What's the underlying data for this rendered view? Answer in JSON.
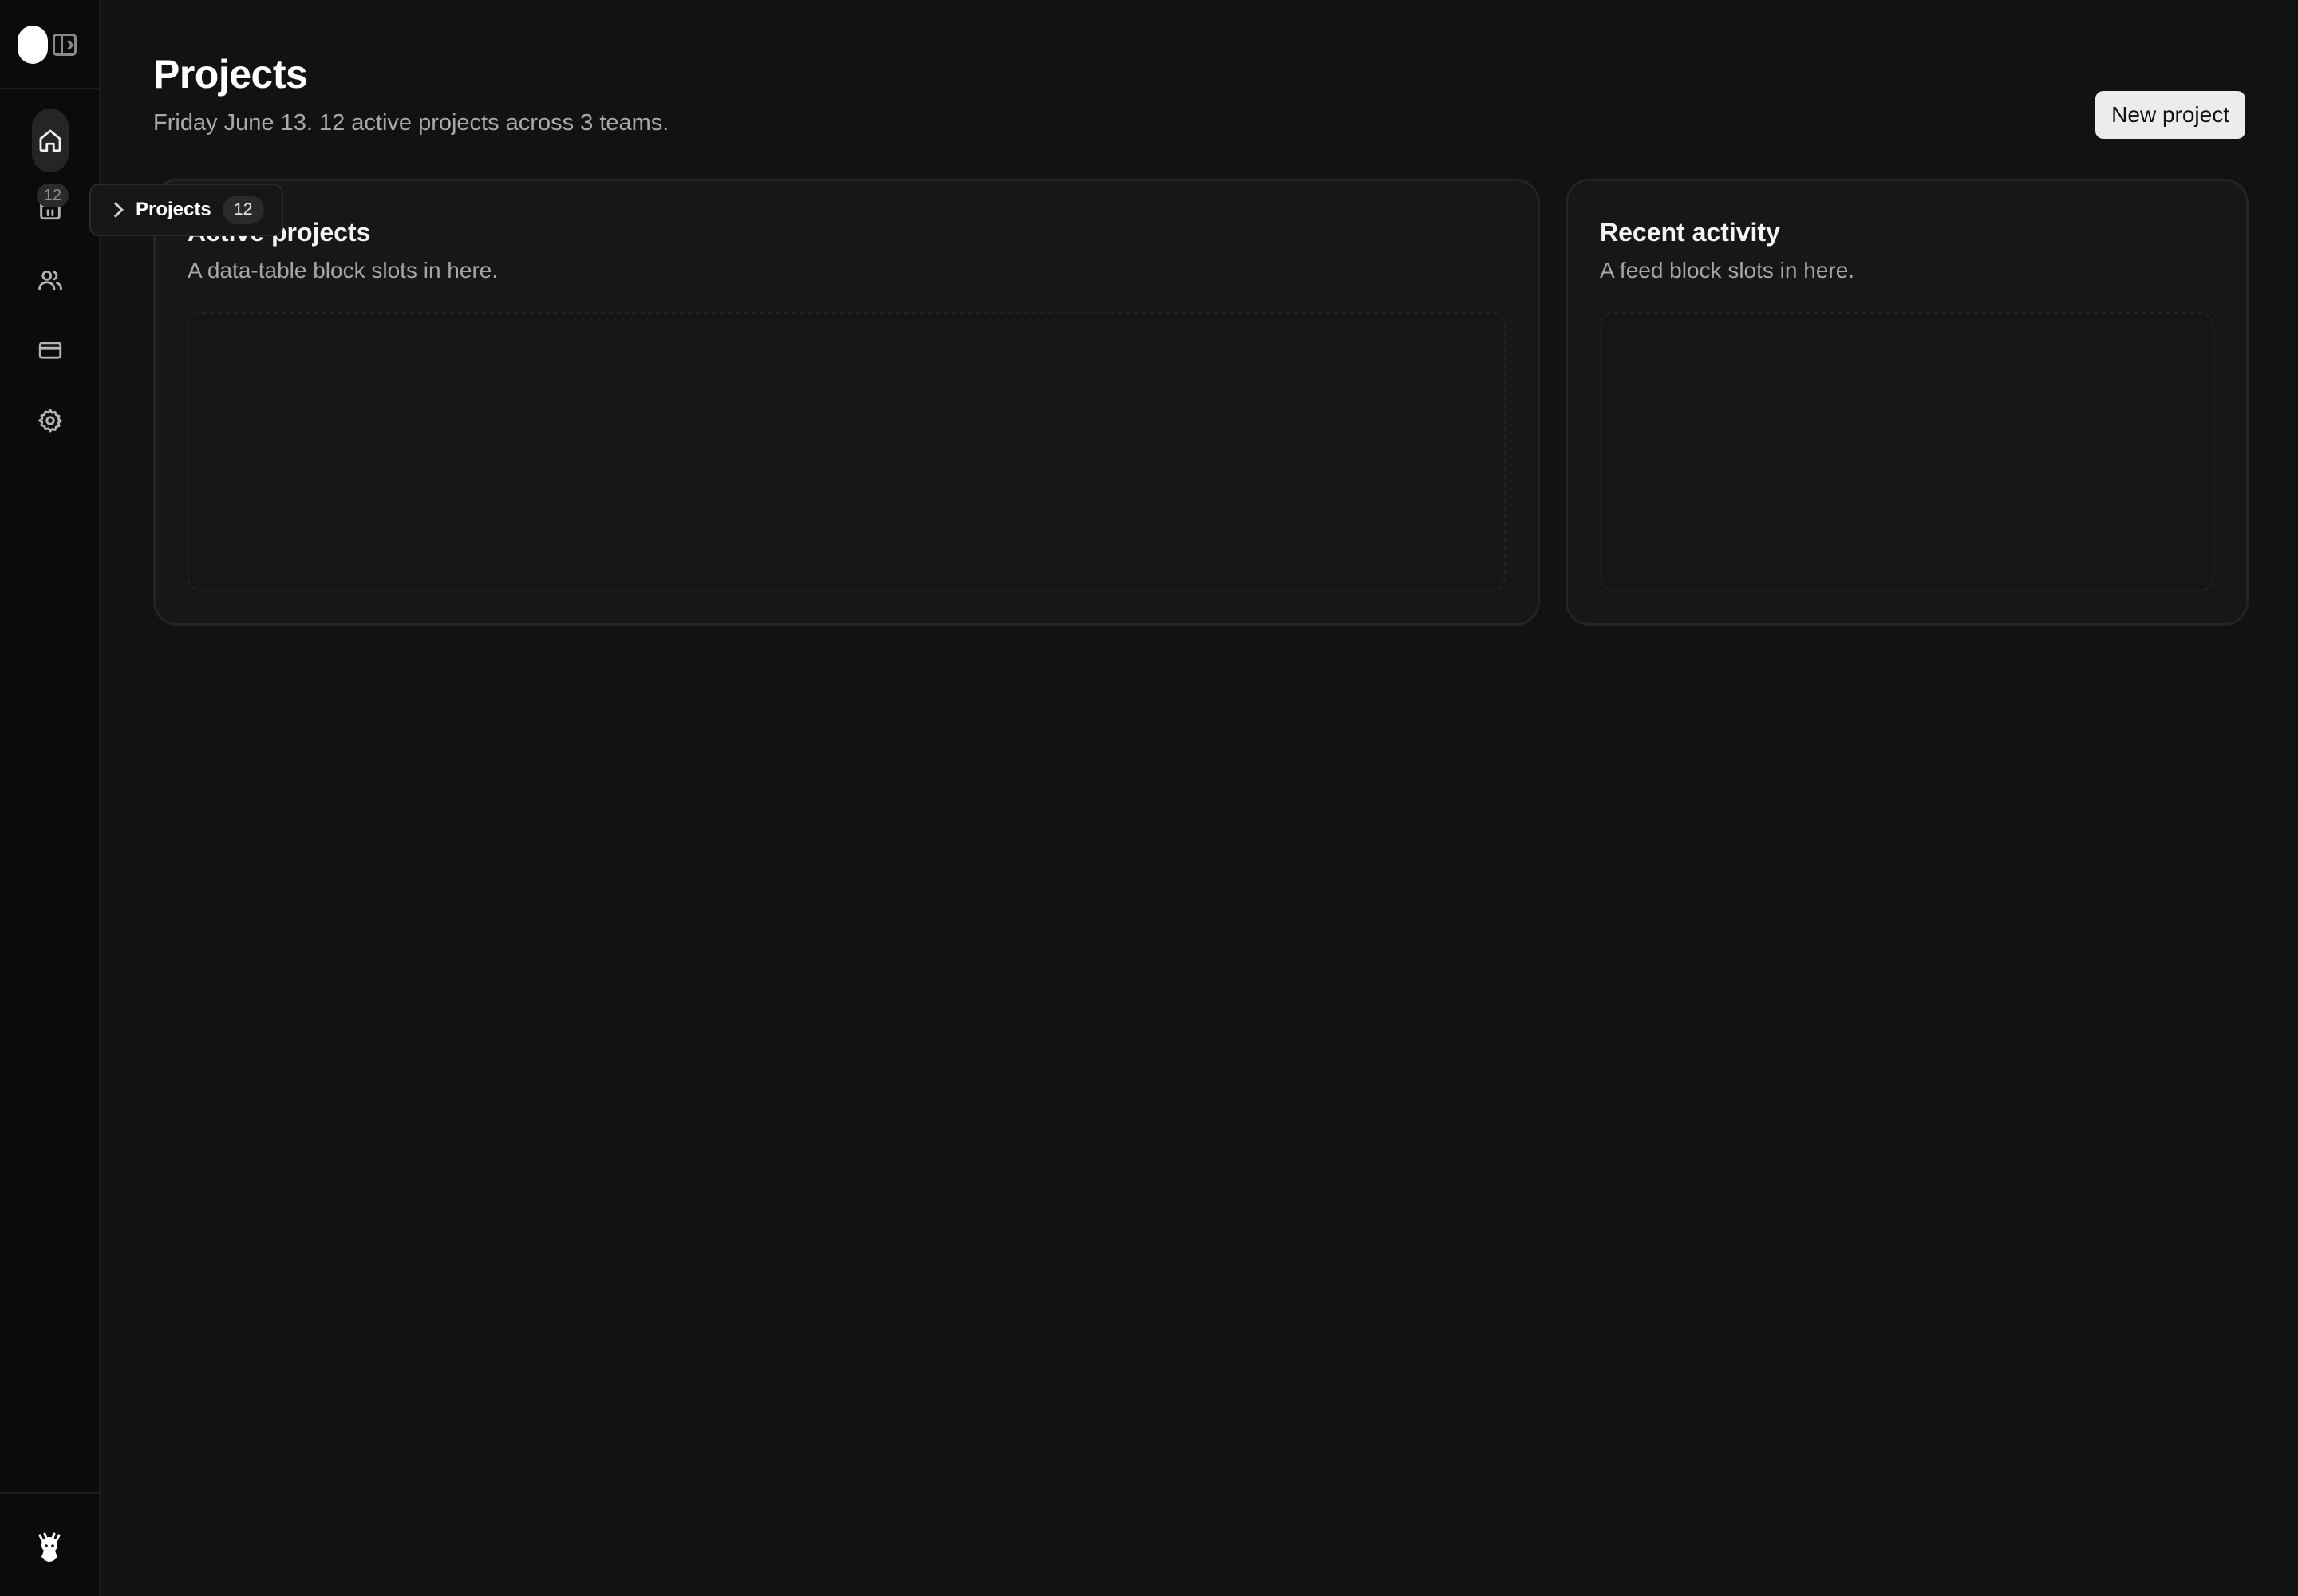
{
  "sidebar": {
    "items": [
      {
        "name": "home",
        "icon": "home-icon"
      },
      {
        "name": "projects",
        "icon": "projects-icon",
        "badge": "12"
      },
      {
        "name": "team",
        "icon": "users-icon"
      },
      {
        "name": "billing",
        "icon": "credit-card-icon"
      },
      {
        "name": "settings",
        "icon": "gear-icon"
      }
    ],
    "flyout": {
      "label": "Projects",
      "count": "12"
    }
  },
  "header": {
    "title": "Projects",
    "subtitle": "Friday June 13. 12 active projects across 3 teams.",
    "new_project_label": "New project"
  },
  "cards": {
    "active": {
      "title": "Active projects",
      "description": "A data-table block slots in here."
    },
    "activity": {
      "title": "Recent activity",
      "description": "A feed block slots in here."
    }
  },
  "colors": {
    "background": "#121212",
    "sidebar": "#0b0b0b",
    "card": "#171717",
    "button": "#ececec"
  }
}
